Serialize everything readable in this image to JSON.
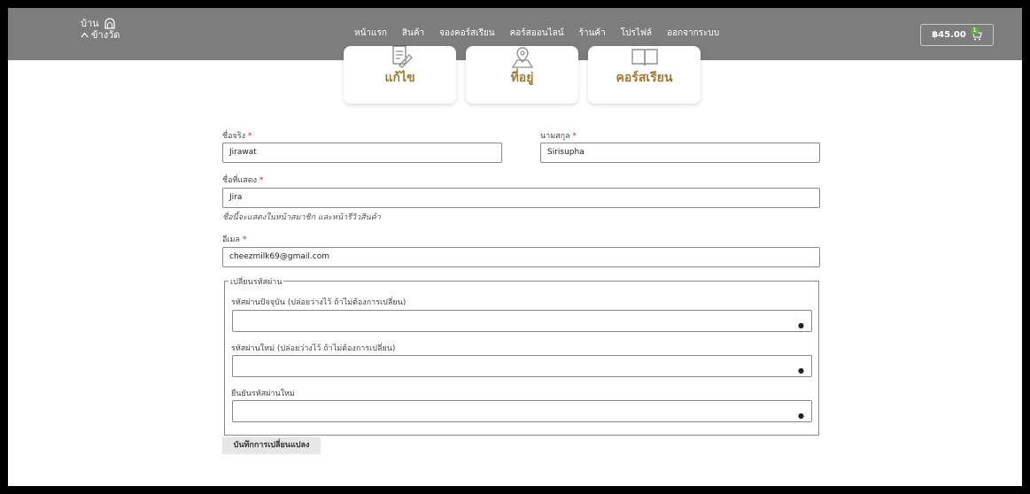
{
  "header": {
    "logo_line1": "บ้าน",
    "logo_line2": "ข้างวัด",
    "nav": [
      "หน้าแรก",
      "สินค้า",
      "จองคอร์สเรียน",
      "คอร์สออนไลน์",
      "ร้านค้า",
      "โปรไฟล์",
      "ออกจากระบบ"
    ],
    "active_nav": "โปรไฟล์",
    "cart_total": "฿45.00",
    "cart_count": "1"
  },
  "cards": [
    {
      "label": "แก้ไข",
      "icon": "edit-document-icon"
    },
    {
      "label": "ที่อยู่",
      "icon": "map-location-icon"
    },
    {
      "label": "คอร์สเรียน",
      "icon": "open-book-icon"
    }
  ],
  "form": {
    "first_name_label": "ชื่อจริง",
    "first_name_value": "Jirawat",
    "last_name_label": "นามสกุล",
    "last_name_value": "Sirisupha",
    "display_name_label": "ชื่อที่แสดง",
    "display_name_value": "Jira",
    "display_name_hint": "ชื่อนี้จะแสดงในหน้าสมาชิก และหน้ารีวิวสินค้า",
    "email_label": "อีเมล",
    "email_value": "cheezmilk69@gmail.com",
    "required_mark": "*",
    "password_legend": "เปลี่ยนรหัสผ่าน",
    "current_password_label": "รหัสผ่านปัจจุบัน (ปล่อยว่างไว้ ถ้าไม่ต้องการเปลี่ยน)",
    "new_password_label": "รหัสผ่านใหม่ (ปล่อยว่างไว้ ถ้าไม่ต้องการเปลี่ยน)",
    "confirm_password_label": "ยืนยันรหัสผ่านใหม่",
    "save_button": "บันทึกการเปลี่ยนแปลง"
  },
  "colors": {
    "topbar": "#7d7d7d",
    "accent": "#a07a30",
    "required": "#d12020"
  }
}
